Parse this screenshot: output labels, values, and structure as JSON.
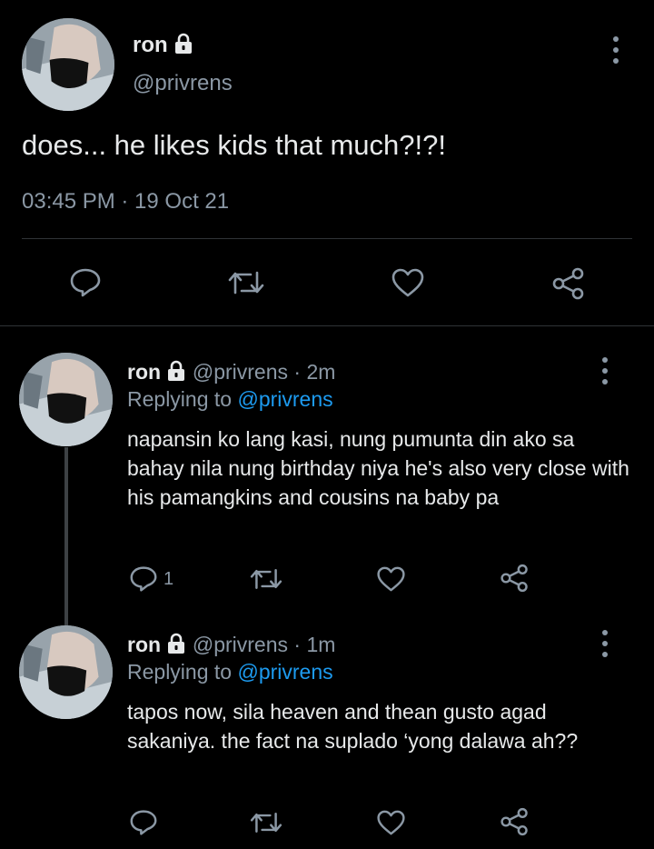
{
  "main_tweet": {
    "name": "ron",
    "handle": "@privrens",
    "text": "does... he likes kids that much?!?!",
    "timestamp": "03:45 PM · 19 Oct 21",
    "icons": [
      "reply-icon",
      "retweet-icon",
      "like-icon",
      "share-icon"
    ]
  },
  "replies": [
    {
      "name": "ron",
      "handle": "@privrens",
      "sep": "·",
      "time": "2m",
      "replying_label": "Replying to",
      "replying_handle": "@privrens",
      "text": "napansin ko lang kasi, nung pumunta din ako sa bahay nila nung birthday niya he's also very close with his pamangkins and cousins na baby pa",
      "reply_count": "1"
    },
    {
      "name": "ron",
      "handle": "@privrens",
      "sep": "·",
      "time": "1m",
      "replying_label": "Replying to",
      "replying_handle": "@privrens",
      "text": "tapos now, sila heaven and thean gusto agad sakaniya. the fact na suplado ‘yong dalawa ah??",
      "reply_count": ""
    }
  ],
  "colors": {
    "background": "#000000",
    "text": "#e7e9ea",
    "muted": "#8b98a5",
    "link": "#1d9bf0",
    "divider": "#2f3336"
  }
}
